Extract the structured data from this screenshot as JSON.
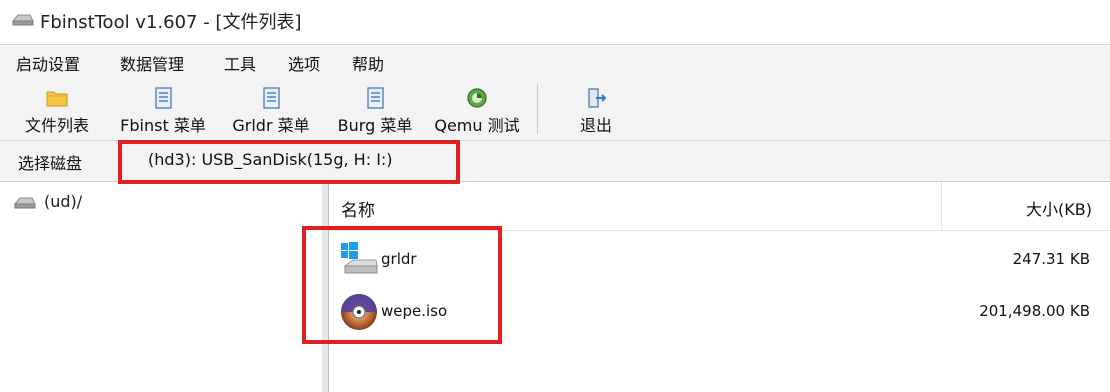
{
  "window": {
    "title": "FbinstTool v1.607 - [文件列表]"
  },
  "menu": [
    "启动设置",
    "数据管理",
    "工具",
    "选项",
    "帮助"
  ],
  "toolbar": {
    "file_list": "文件列表",
    "fbinst_menu": "Fbinst 菜单",
    "grldr_menu": "Grldr 菜单",
    "burg_menu": "Burg 菜单",
    "qemu_test": "Qemu 测试",
    "exit": "退出"
  },
  "disk": {
    "label": "选择磁盘",
    "value": "(hd3): USB_SanDisk(15g, H: I:)"
  },
  "tree": {
    "items": [
      {
        "label": "(ud)/"
      }
    ]
  },
  "list": {
    "columns": {
      "name": "名称",
      "size": "大小(KB)"
    },
    "rows": [
      {
        "name": "grldr",
        "size": "247.31 KB",
        "icon": "windows-drive-icon"
      },
      {
        "name": "wepe.iso",
        "size": "201,498.00 KB",
        "icon": "disc-icon"
      }
    ]
  },
  "colors": {
    "highlight": "#e02020",
    "toolbar_bg": "#f3f3f3"
  }
}
